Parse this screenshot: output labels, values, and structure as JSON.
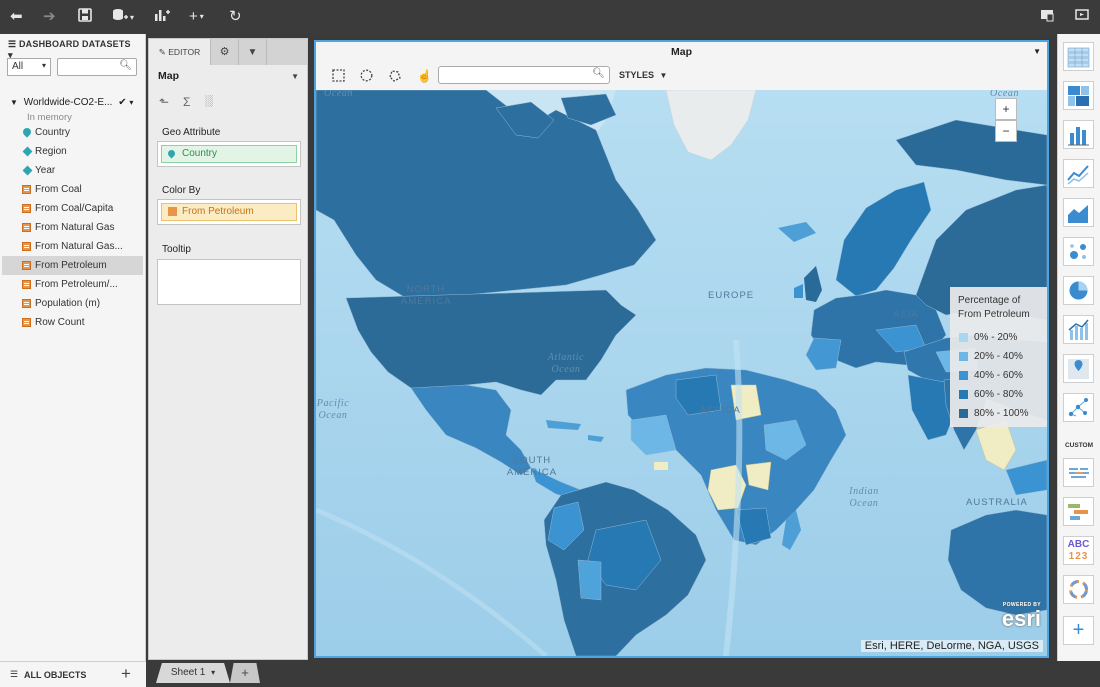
{
  "toolbar": {
    "icons": [
      "back-icon",
      "forward-icon",
      "save-icon",
      "add-data-icon",
      "insert-visualization-icon",
      "add-icon",
      "refresh-icon",
      "format-icon",
      "presentation-icon"
    ]
  },
  "datasets": {
    "header": "DASHBOARD DATASETS",
    "filter_value": "All",
    "search_placeholder": "",
    "dataset_name": "Worldwide-CO2-E...",
    "dataset_status": "In memory",
    "fields": [
      {
        "label": "Country",
        "kind": "geo"
      },
      {
        "label": "Region",
        "kind": "attribute"
      },
      {
        "label": "Year",
        "kind": "attribute"
      },
      {
        "label": "From Coal",
        "kind": "metric"
      },
      {
        "label": "From Coal/Capita",
        "kind": "metric"
      },
      {
        "label": "From Natural Gas",
        "kind": "metric"
      },
      {
        "label": "From Natural Gas...",
        "kind": "metric"
      },
      {
        "label": "From Petroleum",
        "kind": "metric",
        "selected": true
      },
      {
        "label": "From Petroleum/...",
        "kind": "metric"
      },
      {
        "label": "Population (m)",
        "kind": "metric"
      },
      {
        "label": "Row Count",
        "kind": "metric"
      }
    ],
    "footer": "ALL OBJECTS"
  },
  "editor": {
    "tab_editor": "EDITOR",
    "viz_type": "Map",
    "geo_label": "Geo Attribute",
    "geo_value": "Country",
    "color_label": "Color By",
    "color_value": "From Petroleum",
    "tooltip_label": "Tooltip"
  },
  "map": {
    "title": "Map",
    "search_placeholder": "",
    "styles_label": "STYLES",
    "zoom_in": "+",
    "zoom_out": "−",
    "legend": {
      "title": "Percentage of From Petroleum",
      "items": [
        {
          "label": "0% - 20%",
          "color": "#a9d6f2"
        },
        {
          "label": "20% - 40%",
          "color": "#6db7e6"
        },
        {
          "label": "40% - 60%",
          "color": "#3b93d1"
        },
        {
          "label": "60% - 80%",
          "color": "#2779b3"
        },
        {
          "label": "80% - 100%",
          "color": "#2a6a98"
        }
      ]
    },
    "labels": {
      "ocean_top_left": "Ocean",
      "ocean_top_right": "Ocean",
      "north_america": "NORTH AMERICA",
      "europe": "EUROPE",
      "asia": "ASIA",
      "atlantic": "Atlantic Ocean",
      "pacific": "Pacific Ocean",
      "africa": "AFRICA",
      "south_america": "SOUTH AMERICA",
      "indian": "Indian Ocean",
      "australia": "AUSTRALIA"
    },
    "attribution": "Esri, HERE, DeLorme, NGA, USGS",
    "esri_powered": "POWERED BY",
    "esri_logo": "esri"
  },
  "gallery": {
    "custom_label": "CUSTOM",
    "custom_abc": "ABC",
    "custom_123": "123",
    "add": "+"
  },
  "sheets": {
    "active": "Sheet 1",
    "add": "+"
  }
}
